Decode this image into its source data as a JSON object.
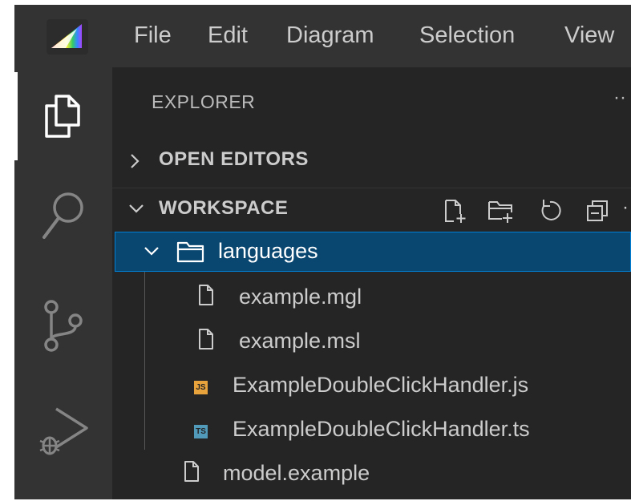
{
  "menubar": {
    "items": [
      "File",
      "Edit",
      "Diagram",
      "Selection",
      "View"
    ]
  },
  "explorer": {
    "title": "EXPLORER",
    "more": "··"
  },
  "sections": {
    "open_editors": "OPEN EDITORS",
    "workspace": "WORKSPACE"
  },
  "tree": {
    "folder": "languages",
    "children": [
      "example.mgl",
      "example.msl",
      "ExampleDoubleClickHandler.js",
      "ExampleDoubleClickHandler.ts"
    ],
    "root_file": "model.example"
  },
  "badges": {
    "js": "JS",
    "ts": "TS"
  },
  "colors": {
    "selection_bg": "#094771",
    "selection_border": "#007fd4",
    "js_badge": "#e8a33d",
    "ts_badge": "#519aba"
  },
  "icons": {
    "activity": [
      "files-icon",
      "search-icon",
      "source-control-icon",
      "run-debug-icon"
    ],
    "workspace_actions": [
      "new-file-icon",
      "new-folder-icon",
      "refresh-icon",
      "collapse-all-icon"
    ]
  }
}
